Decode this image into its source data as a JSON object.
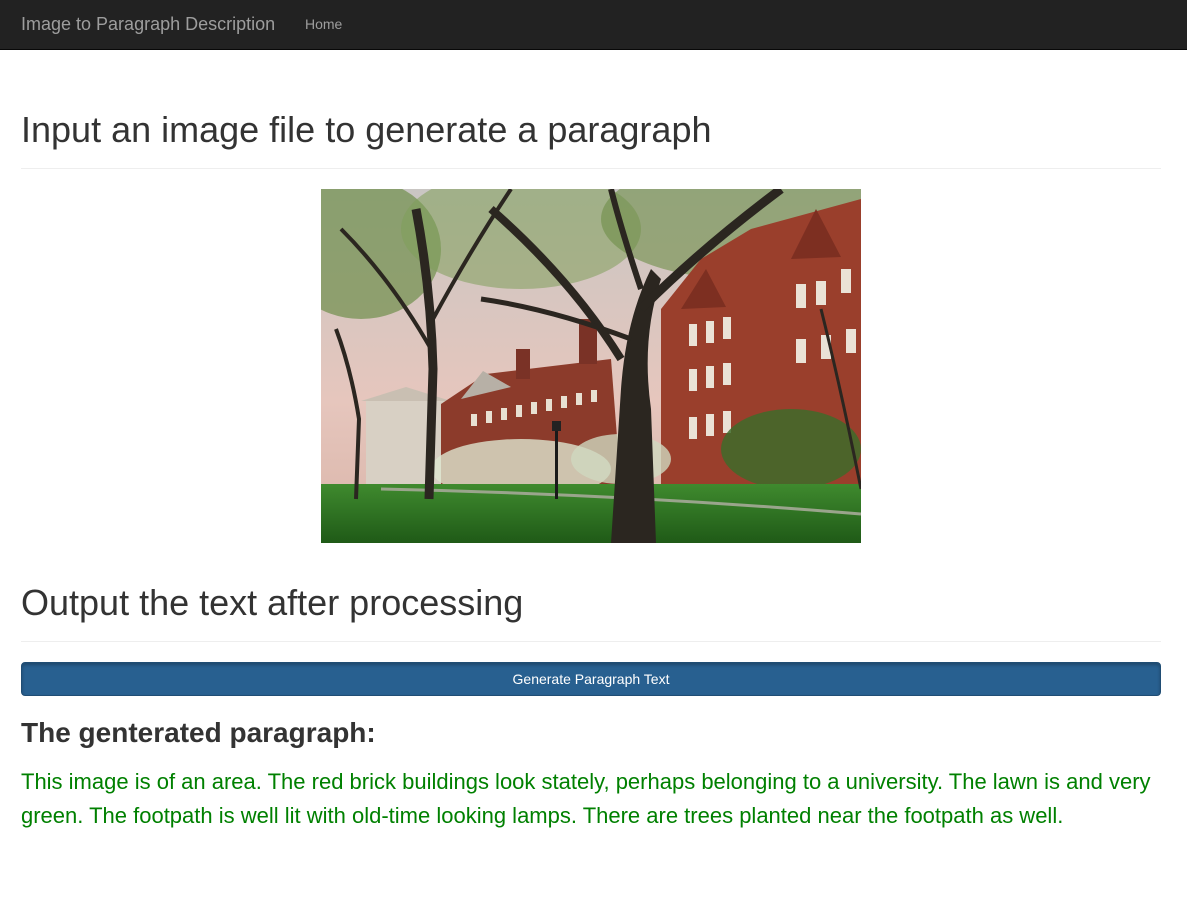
{
  "navbar": {
    "brand": "Image to Paragraph Description",
    "home_label": "Home"
  },
  "input_section": {
    "title": "Input an image file to generate a paragraph"
  },
  "output_section": {
    "title": "Output the text after processing",
    "generate_button_label": "Generate Paragraph Text",
    "result_heading": "The genterated paragraph:",
    "result_text": "This image is of an area. The red brick buildings look stately, perhaps belonging to a university. The lawn is and very green. The footpath is well lit with old-time looking lamps. There are trees planted near the footpath as well."
  },
  "colors": {
    "navbar_bg": "#222222",
    "nav_text": "#9d9d9d",
    "button_bg": "#286090",
    "result_text": "#008000"
  }
}
